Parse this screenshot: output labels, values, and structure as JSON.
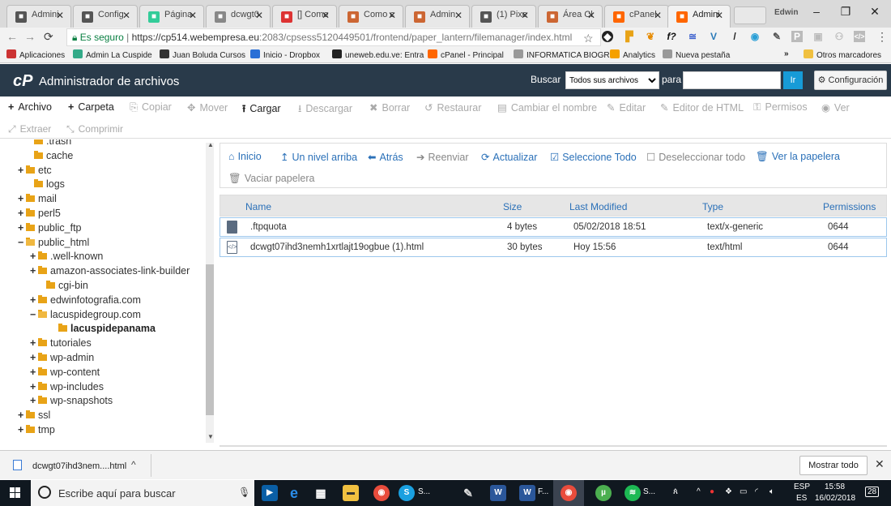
{
  "browser": {
    "tabs": [
      {
        "label": "Admini",
        "icon": "app-icon",
        "color": "#555"
      },
      {
        "label": "Config",
        "icon": "app-icon",
        "color": "#555"
      },
      {
        "label": "Página",
        "icon": "site-icon",
        "color": "#3c9"
      },
      {
        "label": "dcwgt0",
        "icon": "page-icon",
        "color": "#888"
      },
      {
        "label": "[] Come",
        "icon": "gmail-icon",
        "color": "#d33"
      },
      {
        "label": "Como c",
        "icon": "u-icon",
        "color": "#c63"
      },
      {
        "label": "Admin",
        "icon": "u-icon",
        "color": "#c63"
      },
      {
        "label": "(1) Pixe",
        "icon": "app-icon",
        "color": "#555"
      },
      {
        "label": "Área Cl",
        "icon": "u-icon",
        "color": "#c63"
      },
      {
        "label": "cPanel",
        "icon": "cpanel-icon",
        "color": "#f60"
      },
      {
        "label": "Admini",
        "icon": "cpanel-icon",
        "color": "#f60"
      }
    ],
    "profile": "Edwin",
    "url_secure": "Es seguro",
    "url_host": "https://cp514.webempresa.eu",
    "url_rest": ":2083/cpsess5120449501/frontend/paper_lantern/filemanager/index.html",
    "bookmarks": [
      {
        "label": "Aplicaciones",
        "color": "#c33"
      },
      {
        "label": "Admin La Cuspide",
        "color": "#3a8"
      },
      {
        "label": "Juan Boluda Cursos",
        "color": "#333"
      },
      {
        "label": "Inicio - Dropbox",
        "color": "#2a6fd6"
      },
      {
        "label": "uneweb.edu.ve: Entra",
        "color": "#222"
      },
      {
        "label": "cPanel - Principal",
        "color": "#f60"
      },
      {
        "label": "INFORMATICA BIOGR",
        "color": "#999"
      },
      {
        "label": "Analytics",
        "color": "#f5a000"
      },
      {
        "label": "Nueva pestaña",
        "color": "#999"
      }
    ],
    "bookmarks_more": "»",
    "other_bookmarks": "Otros marcadores"
  },
  "cpanel": {
    "logo": "cP",
    "title": "Administrador de archivos",
    "search_label": "Buscar",
    "search_scope": "Todos sus archivos",
    "for_label": "para",
    "go_label": "Ir",
    "settings_label": "Configuración"
  },
  "toolbar": [
    {
      "label": "Archivo",
      "icon": "+",
      "enabled": true
    },
    {
      "label": "Carpeta",
      "icon": "+",
      "enabled": true
    },
    {
      "label": "Copiar",
      "icon": "⎘",
      "enabled": false
    },
    {
      "label": "Mover",
      "icon": "✥",
      "enabled": false
    },
    {
      "label": "Cargar",
      "icon": "⭱",
      "enabled": true
    },
    {
      "label": "Descargar",
      "icon": "⭳",
      "enabled": false
    },
    {
      "label": "Borrar",
      "icon": "✖",
      "enabled": false
    },
    {
      "label": "Restaurar",
      "icon": "↺",
      "enabled": false
    },
    {
      "label": "Cambiar el nombre",
      "icon": "▤",
      "enabled": false
    },
    {
      "label": "Editar",
      "icon": "✎",
      "enabled": false
    },
    {
      "label": "Editor de HTML",
      "icon": "✎",
      "enabled": false
    },
    {
      "label": "Permisos",
      "icon": "⚿",
      "enabled": false
    },
    {
      "label": "Ver",
      "icon": "◉",
      "enabled": false
    },
    {
      "label": "Extraer",
      "icon": "⤢",
      "enabled": false
    },
    {
      "label": "Comprimir",
      "icon": "⤡",
      "enabled": false
    }
  ],
  "tree": [
    {
      "label": ".trash",
      "prefix": "",
      "open": false,
      "bold": false
    },
    {
      "label": "cache",
      "prefix": "",
      "open": false,
      "bold": false
    },
    {
      "label": "etc",
      "prefix": "+",
      "open": false,
      "bold": false
    },
    {
      "label": "logs",
      "prefix": "",
      "open": false,
      "bold": false
    },
    {
      "label": "mail",
      "prefix": "+",
      "open": false,
      "bold": false
    },
    {
      "label": "perl5",
      "prefix": "+",
      "open": false,
      "bold": false
    },
    {
      "label": "public_ftp",
      "prefix": "+",
      "open": false,
      "bold": false
    },
    {
      "label": "public_html",
      "prefix": "−",
      "open": true,
      "bold": false
    },
    {
      "label": ".well-known",
      "prefix": "+",
      "open": false,
      "bold": false
    },
    {
      "label": "amazon-associates-link-builder",
      "prefix": "+",
      "open": false,
      "bold": false
    },
    {
      "label": "cgi-bin",
      "prefix": "",
      "open": false,
      "bold": false
    },
    {
      "label": "edwinfotografia.com",
      "prefix": "+",
      "open": false,
      "bold": false
    },
    {
      "label": "lacuspidegroup.com",
      "prefix": "−",
      "open": true,
      "bold": false
    },
    {
      "label": "lacuspidepanama",
      "prefix": "",
      "open": false,
      "bold": true
    },
    {
      "label": "tutoriales",
      "prefix": "+",
      "open": false,
      "bold": false
    },
    {
      "label": "wp-admin",
      "prefix": "+",
      "open": false,
      "bold": false
    },
    {
      "label": "wp-content",
      "prefix": "+",
      "open": false,
      "bold": false
    },
    {
      "label": "wp-includes",
      "prefix": "+",
      "open": false,
      "bold": false
    },
    {
      "label": "wp-snapshots",
      "prefix": "+",
      "open": false,
      "bold": false
    },
    {
      "label": "ssl",
      "prefix": "+",
      "open": false,
      "bold": false
    },
    {
      "label": "tmp",
      "prefix": "+",
      "open": false,
      "bold": false
    }
  ],
  "navbar": [
    {
      "label": "Inicio",
      "icon": "⌂",
      "enabled": true
    },
    {
      "label": "Un nivel arriba",
      "icon": "↥",
      "enabled": true
    },
    {
      "label": "Atrás",
      "icon": "⬅",
      "enabled": true
    },
    {
      "label": "Reenviar",
      "icon": "➔",
      "enabled": false
    },
    {
      "label": "Actualizar",
      "icon": "⟳",
      "enabled": true
    },
    {
      "label": "Seleccione Todo",
      "icon": "☑",
      "enabled": true
    },
    {
      "label": "Deseleccionar todo",
      "icon": "☐",
      "enabled": false
    },
    {
      "label": "Ver la papelera",
      "icon": "🗑",
      "enabled": true
    },
    {
      "label": "Vaciar papelera",
      "icon": "🗑",
      "enabled": false
    }
  ],
  "table": {
    "headers": {
      "name": "Name",
      "size": "Size",
      "modified": "Last Modified",
      "type": "Type",
      "perms": "Permissions"
    },
    "rows": [
      {
        "name": ".ftpquota",
        "size": "4 bytes",
        "modified": "05/02/2018 18:51",
        "type": "text/x-generic",
        "perms": "0644",
        "icon": "file-icon"
      },
      {
        "name": "dcwgt07ihd3nemh1xrtlajt19ogbue (1).html",
        "size": "30 bytes",
        "modified": "Hoy 15:56",
        "type": "text/html",
        "perms": "0644",
        "icon": "html-file-icon"
      }
    ]
  },
  "download": {
    "filename": "dcwgt07ihd3nem....html",
    "show_all": "Mostrar todo"
  },
  "taskbar": {
    "search_placeholder": "Escribe aquí para buscar",
    "app_s1": "S...",
    "app_f": "F...",
    "app_s2": "S...",
    "lang": "ESP",
    "lang2": "ES",
    "time": "15:58",
    "date": "16/02/2018",
    "notif": "28"
  }
}
